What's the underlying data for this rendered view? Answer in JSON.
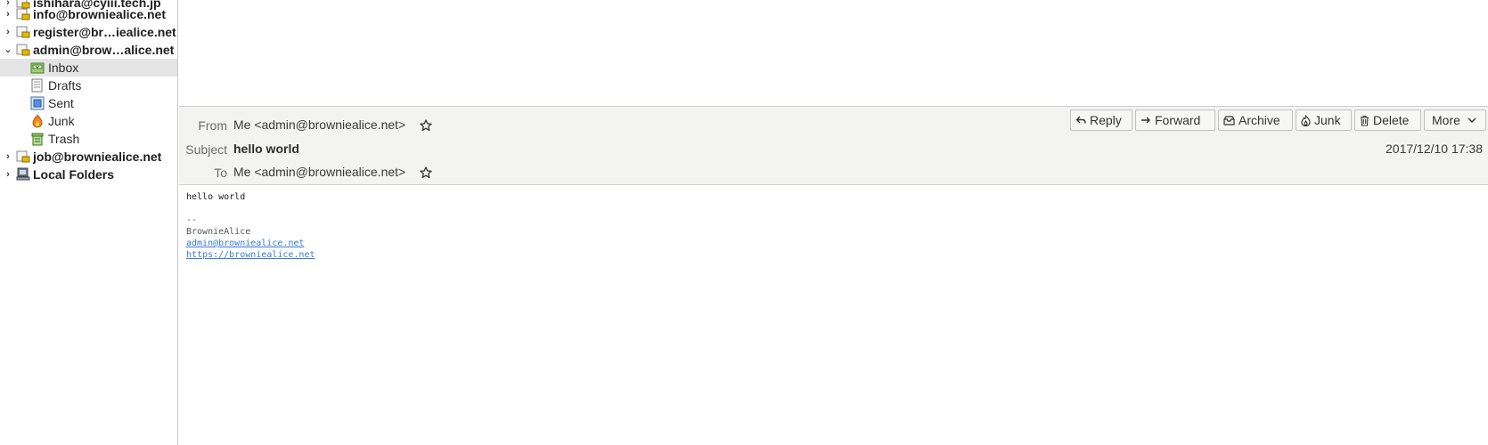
{
  "folder_pane": {
    "accounts_top": [
      {
        "label": "ishihara@cyiii.tech.jp"
      },
      {
        "label": "info@browniealice.net"
      },
      {
        "label": "register@br…iealice.net"
      },
      {
        "label": "admin@brow…alice.net"
      }
    ],
    "admin_folders": [
      {
        "label": "Inbox",
        "icon": "inbox-icon",
        "selected": true
      },
      {
        "label": "Drafts",
        "icon": "drafts-icon"
      },
      {
        "label": "Sent",
        "icon": "sent-icon"
      },
      {
        "label": "Junk",
        "icon": "junk-icon"
      },
      {
        "label": "Trash",
        "icon": "trash-icon"
      }
    ],
    "accounts_bottom": [
      {
        "label": "job@browniealice.net"
      },
      {
        "label": "Local Folders"
      }
    ]
  },
  "header": {
    "from_label": "From",
    "from_value": "Me <admin@browniealice.net>",
    "subject_label": "Subject",
    "subject_value": "hello world",
    "to_label": "To",
    "to_value": "Me <admin@browniealice.net>",
    "date": "2017/12/10 17:38",
    "toolbar": {
      "reply": "Reply",
      "forward": "Forward",
      "archive": "Archive",
      "junk": "Junk",
      "delete": "Delete",
      "more": "More"
    }
  },
  "body": {
    "line1": "hello world",
    "sig_sep": "--",
    "sig_name": "BrownieAlice",
    "sig_email": "admin@browniealice.net",
    "sig_url": "https://browniealice.net"
  },
  "colors": {
    "accent_link": "#3a7bd5",
    "header_bg": "#f3f3f2",
    "selection_bg": "#e4e4e4"
  }
}
